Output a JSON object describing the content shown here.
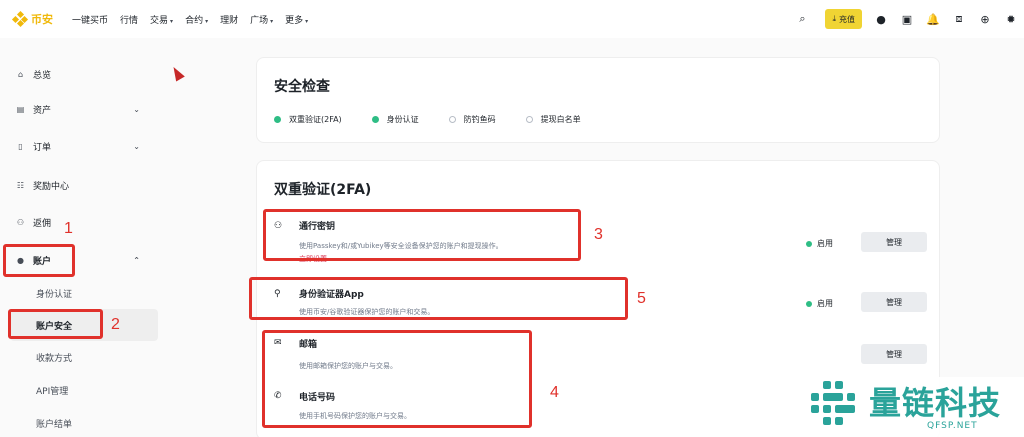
{
  "brand": {
    "name": "币安",
    "color": "#f0b90b"
  },
  "nav": [
    {
      "label": "一键买币",
      "caret": false
    },
    {
      "label": "行情",
      "caret": false
    },
    {
      "label": "交易",
      "caret": true
    },
    {
      "label": "合约",
      "caret": true
    },
    {
      "label": "理财",
      "caret": false
    },
    {
      "label": "广场",
      "caret": true
    },
    {
      "label": "更多",
      "caret": true
    }
  ],
  "topright": {
    "deposit_label": "充值",
    "icons": [
      "search-icon",
      "download-icon",
      "profile-icon",
      "wallet-icon",
      "bell-icon",
      "qr-icon",
      "globe-icon",
      "theme-icon"
    ]
  },
  "sidebar": {
    "overview": "总览",
    "assets": "资产",
    "orders": "订单",
    "rewards": "奖励中心",
    "referral": "返佣",
    "account": "账户",
    "identity": "身份认证",
    "security": "账户安全",
    "payment": "收款方式",
    "api": "API管理",
    "statement": "账户结单"
  },
  "security_check": {
    "title": "安全检查",
    "items": [
      {
        "label": "双重验证(2FA)",
        "done": true
      },
      {
        "label": "身份认证",
        "done": true
      },
      {
        "label": "防钓鱼码",
        "done": false
      },
      {
        "label": "提现白名单",
        "done": false
      }
    ]
  },
  "twofa": {
    "title": "双重验证(2FA)",
    "passkey": {
      "title": "通行密钥",
      "desc": "使用Passkey和/或Yubikey等安全设备保护您的账户和提现操作。",
      "link": "立即设置",
      "status": "启用",
      "manage": "管理"
    },
    "authenticator": {
      "title": "身份验证器App",
      "desc": "使用币安/谷歌验证器保护您的账户和交易。",
      "status": "启用",
      "manage": "管理"
    },
    "email": {
      "title": "邮箱",
      "desc": "使用邮箱保护您的账户与交易。",
      "manage": "管理"
    },
    "phone": {
      "title": "电话号码",
      "desc": "使用手机号码保护您的账户与交易。"
    }
  },
  "annotations": {
    "n1": "1",
    "n2": "2",
    "n3": "3",
    "n4": "4",
    "n5": "5",
    "color": "#e0312b"
  },
  "watermark": {
    "text": "量链科技",
    "sub": "QFSP.NET",
    "color": "#2aa39a"
  }
}
